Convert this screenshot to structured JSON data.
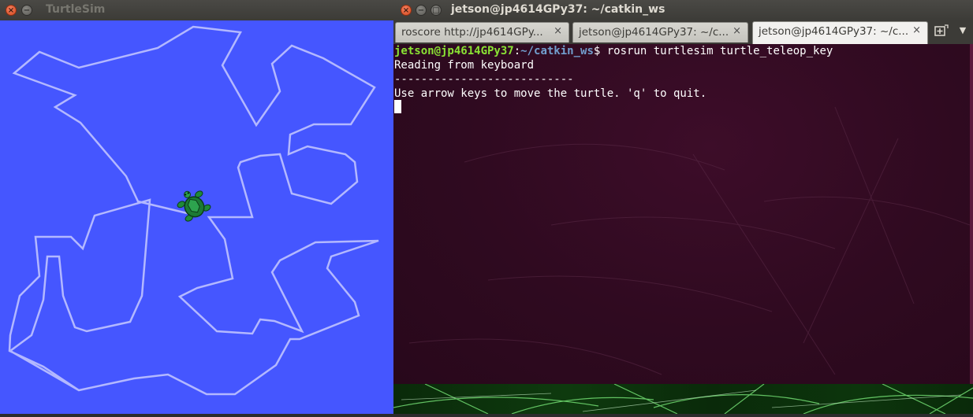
{
  "turtlesim": {
    "title": "TurtleSim",
    "background_color": "#4556ff",
    "path_color": "#b3b8ff",
    "turtle_icon": "turtle-icon"
  },
  "terminal": {
    "title": "jetson@jp4614GPy37: ~/catkin_ws",
    "tabs": [
      {
        "label": "roscore http://jp4614GPy...",
        "active": false
      },
      {
        "label": "jetson@jp4614GPy37: ~/c...",
        "active": false
      },
      {
        "label": "jetson@jp4614GPy37: ~/c...",
        "active": true
      }
    ],
    "prompt": {
      "user_host": "jetson@jp4614GPy37",
      "separator": ":",
      "path": "~/catkin_ws",
      "symbol": "$",
      "command": " rosrun turtlesim turtle_teleop_key"
    },
    "output_lines": [
      "Reading from keyboard",
      "---------------------------",
      "Use arrow keys to move the turtle. 'q' to quit."
    ],
    "colors": {
      "background": "#2f0a20",
      "prompt_user": "#8ae234",
      "prompt_path": "#729fcf",
      "text": "#ffffff"
    }
  },
  "window_controls": {
    "close": "close-icon",
    "minimize": "minimize-icon",
    "maximize": "maximize-icon",
    "close_glyph": "×",
    "minimize_glyph": "−",
    "maximize_glyph": "□"
  }
}
